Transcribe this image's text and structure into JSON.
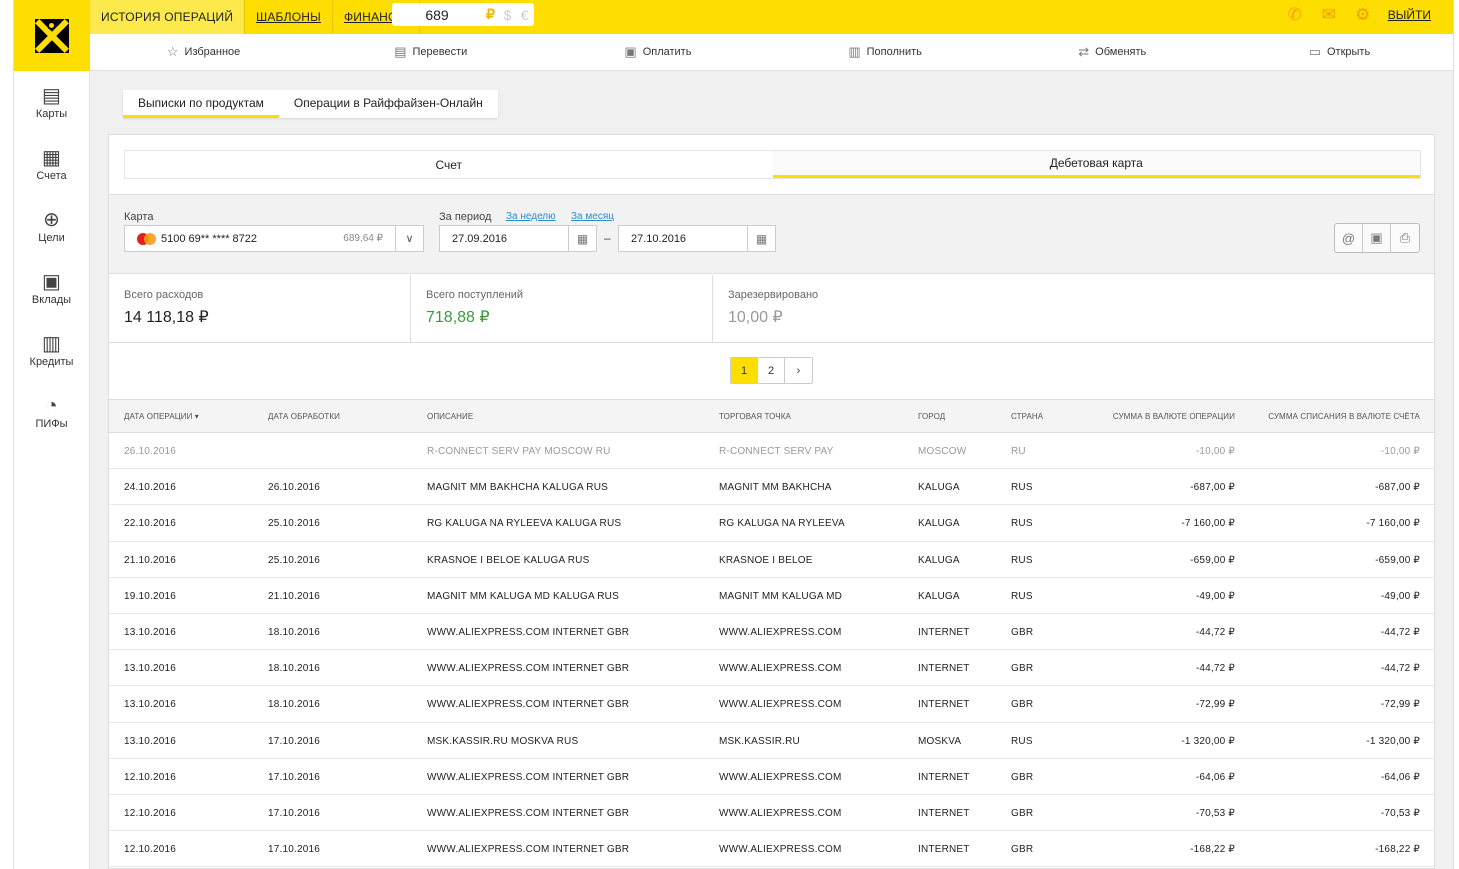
{
  "header": {
    "tabs": [
      {
        "label": "ИСТОРИЯ ОПЕРАЦИЙ",
        "active": true,
        "link": false
      },
      {
        "label": "ШАБЛОНЫ",
        "active": false,
        "link": true
      },
      {
        "label": "ФИНАНСЫ",
        "active": false,
        "link": true
      }
    ],
    "balance": {
      "amount": "689",
      "currencies": [
        "₽",
        "$",
        "€"
      ],
      "active_currency": "₽"
    },
    "logout_label": "ВЫЙТИ",
    "brand_color": "#fedd00"
  },
  "actions": [
    {
      "label": "Избранное",
      "icon": "star-icon"
    },
    {
      "label": "Перевести",
      "icon": "transfer-icon"
    },
    {
      "label": "Оплатить",
      "icon": "pay-icon"
    },
    {
      "label": "Пополнить",
      "icon": "topup-icon"
    },
    {
      "label": "Обменять",
      "icon": "exchange-icon"
    },
    {
      "label": "Открыть",
      "icon": "open-icon"
    }
  ],
  "sidebar": [
    {
      "label": "Карты",
      "icon": "cards-icon"
    },
    {
      "label": "Счета",
      "icon": "accounts-icon"
    },
    {
      "label": "Цели",
      "icon": "goals-icon"
    },
    {
      "label": "Вклады",
      "icon": "deposits-icon"
    },
    {
      "label": "Кредиты",
      "icon": "credits-icon"
    },
    {
      "label": "ПИФы",
      "icon": "funds-icon"
    }
  ],
  "page_tabs": [
    {
      "label": "Выписки по продуктам",
      "active": true
    },
    {
      "label": "Операции в Райффайзен-Онлайн",
      "active": false
    }
  ],
  "sub_tabs": [
    {
      "label": "Счет",
      "active": false
    },
    {
      "label": "Дебетовая карта",
      "active": true
    }
  ],
  "filter": {
    "card_label": "Карта",
    "card_number": "5100 69** **** 8722",
    "card_balance": "689,64 ₽",
    "period_label": "За период",
    "week_link": "За неделю",
    "month_link": "За месяц",
    "date_from": "27.09.2016",
    "date_to": "27.10.2016",
    "dash": "–"
  },
  "totals": [
    {
      "label": "Всего расходов",
      "value": "14 118,18 ₽"
    },
    {
      "label": "Всего поступлений",
      "value": "718,88 ₽"
    },
    {
      "label": "Зарезервировано",
      "value": "10,00 ₽"
    }
  ],
  "pagination": {
    "pages": [
      "1",
      "2"
    ],
    "current": "1",
    "next": "›"
  },
  "table": {
    "columns": [
      "ДАТА ОПЕРАЦИИ ▾",
      "ДАТА ОБРАБОТКИ",
      "ОПИСАНИЕ",
      "ТОРГОВАЯ ТОЧКА",
      "ГОРОД",
      "СТРАНА",
      "СУММА В ВАЛЮТЕ ОПЕРАЦИИ",
      "СУММА СПИСАНИЯ В ВАЛЮТЕ СЧЁТА"
    ],
    "rows": [
      [
        "26.10.2016",
        "",
        "R-CONNECT SERV PAY MOSCOW RU",
        "R-CONNECT SERV PAY",
        "MOSCOW",
        "RU",
        "-10,00 ₽",
        "-10,00 ₽"
      ],
      [
        "24.10.2016",
        "26.10.2016",
        "MAGNIT MM BAKHCHA KALUGA RUS",
        "MAGNIT MM BAKHCHA",
        "KALUGA",
        "RUS",
        "-687,00 ₽",
        "-687,00 ₽"
      ],
      [
        "22.10.2016",
        "25.10.2016",
        "RG KALUGA NA RYLEEVA KALUGA RUS",
        "RG KALUGA NA RYLEEVA",
        "KALUGA",
        "RUS",
        "-7 160,00 ₽",
        "-7 160,00 ₽"
      ],
      [
        "21.10.2016",
        "25.10.2016",
        "KRASNOE I BELOE KALUGA RUS",
        "KRASNOE I BELOE",
        "KALUGA",
        "RUS",
        "-659,00 ₽",
        "-659,00 ₽"
      ],
      [
        "19.10.2016",
        "21.10.2016",
        "MAGNIT MM KALUGA MD KALUGA RUS",
        "MAGNIT MM KALUGA MD",
        "KALUGA",
        "RUS",
        "-49,00 ₽",
        "-49,00 ₽"
      ],
      [
        "13.10.2016",
        "18.10.2016",
        "WWW.ALIEXPRESS.COM INTERNET GBR",
        "WWW.ALIEXPRESS.COM",
        "INTERNET",
        "GBR",
        "-44,72 ₽",
        "-44,72 ₽"
      ],
      [
        "13.10.2016",
        "18.10.2016",
        "WWW.ALIEXPRESS.COM INTERNET GBR",
        "WWW.ALIEXPRESS.COM",
        "INTERNET",
        "GBR",
        "-44,72 ₽",
        "-44,72 ₽"
      ],
      [
        "13.10.2016",
        "18.10.2016",
        "WWW.ALIEXPRESS.COM INTERNET GBR",
        "WWW.ALIEXPRESS.COM",
        "INTERNET",
        "GBR",
        "-72,99 ₽",
        "-72,99 ₽"
      ],
      [
        "13.10.2016",
        "17.10.2016",
        "MSK.KASSIR.RU MOSKVA RUS",
        "MSK.KASSIR.RU",
        "MOSKVA",
        "RUS",
        "-1 320,00 ₽",
        "-1 320,00 ₽"
      ],
      [
        "12.10.2016",
        "17.10.2016",
        "WWW.ALIEXPRESS.COM INTERNET GBR",
        "WWW.ALIEXPRESS.COM",
        "INTERNET",
        "GBR",
        "-64,06 ₽",
        "-64,06 ₽"
      ],
      [
        "12.10.2016",
        "17.10.2016",
        "WWW.ALIEXPRESS.COM INTERNET GBR",
        "WWW.ALIEXPRESS.COM",
        "INTERNET",
        "GBR",
        "-70,53 ₽",
        "-70,53 ₽"
      ],
      [
        "12.10.2016",
        "17.10.2016",
        "WWW.ALIEXPRESS.COM INTERNET GBR",
        "WWW.ALIEXPRESS.COM",
        "INTERNET",
        "GBR",
        "-168,22 ₽",
        "-168,22 ₽"
      ]
    ]
  }
}
